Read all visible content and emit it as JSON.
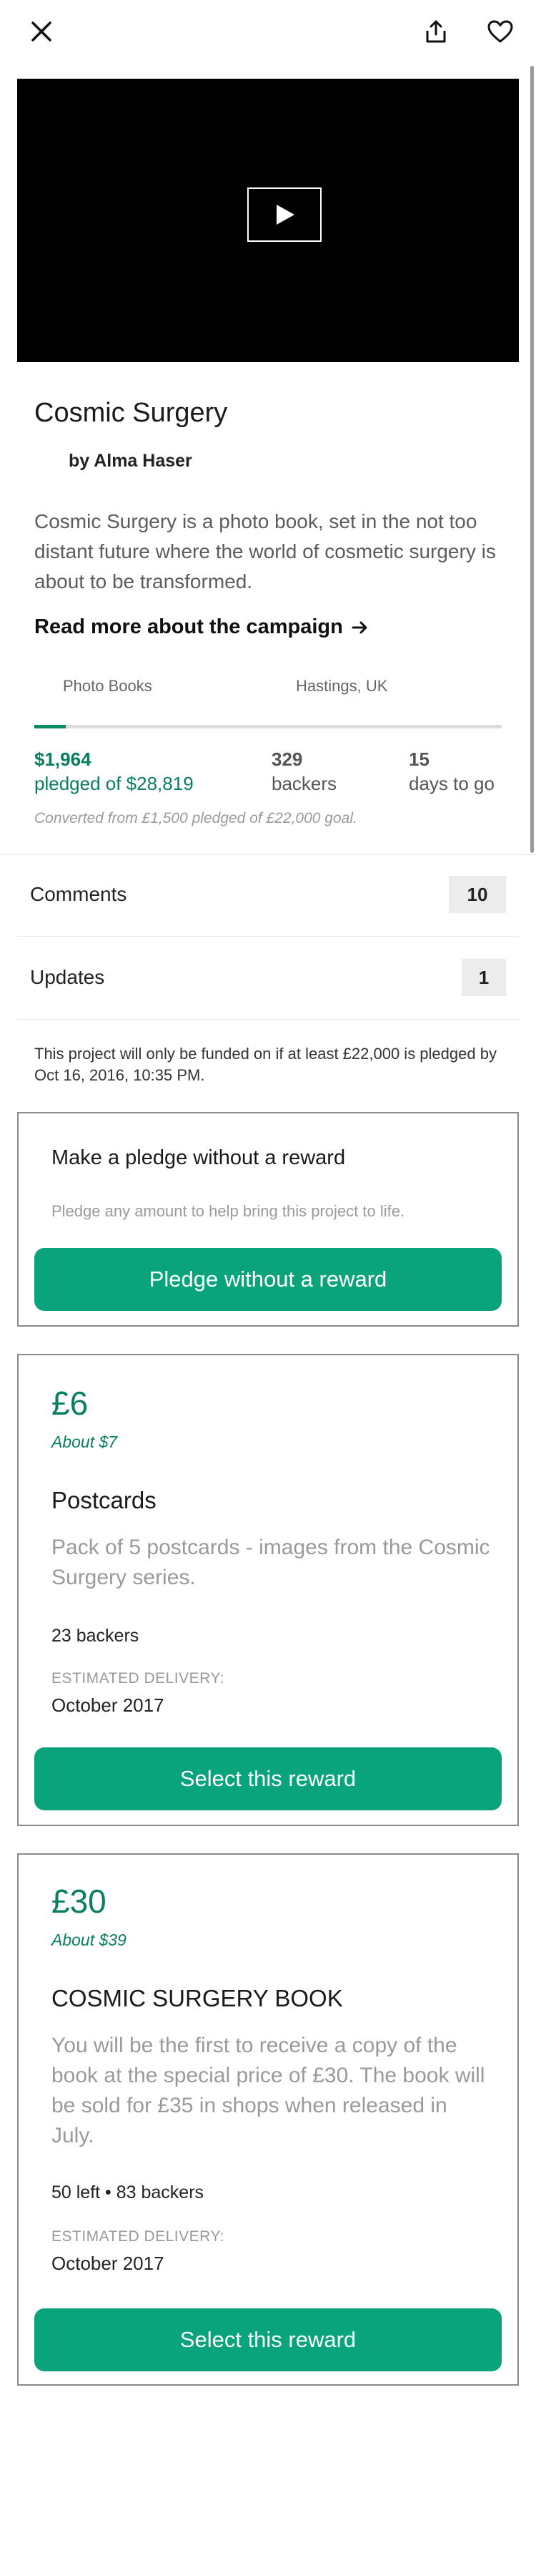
{
  "nav": {
    "close_icon": "close-icon",
    "share_icon": "share-icon",
    "heart_icon": "heart-icon"
  },
  "project": {
    "title": "Cosmic Surgery",
    "creator": "by Alma Haser",
    "blurb": "Cosmic Surgery is a photo book, set in the not too distant future where the world of cosmetic surgery is about to be transformed.",
    "read_more": "Read more about the campaign",
    "category": "Photo Books",
    "location": "Hastings, UK",
    "progress_fraction": 0.068,
    "pledged_amount": "$1,964",
    "pledged_goal": "pledged of $28,819",
    "backers_count": "329",
    "backers_label": "backers",
    "days_count": "15",
    "days_label": "days to go",
    "converted_note": "Converted from £1,500 pledged of £22,000 goal."
  },
  "rows": {
    "comments_label": "Comments",
    "comments_count": "10",
    "updates_label": "Updates",
    "updates_count": "1"
  },
  "funding_note": "This project will only be funded on if at least £22,000 is pledged by Oct 16, 2016, 10:35 PM.",
  "no_reward": {
    "title": "Make a pledge without a reward",
    "subtitle": "Pledge any amount to help bring this project to life.",
    "button": "Pledge without a reward"
  },
  "rewards": [
    {
      "price": "£6",
      "converted": "About $7",
      "title": "Postcards",
      "description": "Pack of 5 postcards - images from the Cosmic Surgery series.",
      "backers": "23 backers",
      "delivery_label": "ESTIMATED DELIVERY:",
      "delivery": "October 2017",
      "button": "Select this reward"
    },
    {
      "price": "£30",
      "converted": "About $39",
      "title": "COSMIC SURGERY BOOK",
      "description": "You will be the first to receive a copy of the book at the special price of £30. The book will be sold for £35 in shops when released in July.",
      "backers": "50 left • 83 backers",
      "delivery_label": "ESTIMATED DELIVERY:",
      "delivery": "October 2017",
      "button": "Select this reward"
    }
  ],
  "colors": {
    "accent": "#0aa47c",
    "accent_text": "#0a7f5e"
  }
}
